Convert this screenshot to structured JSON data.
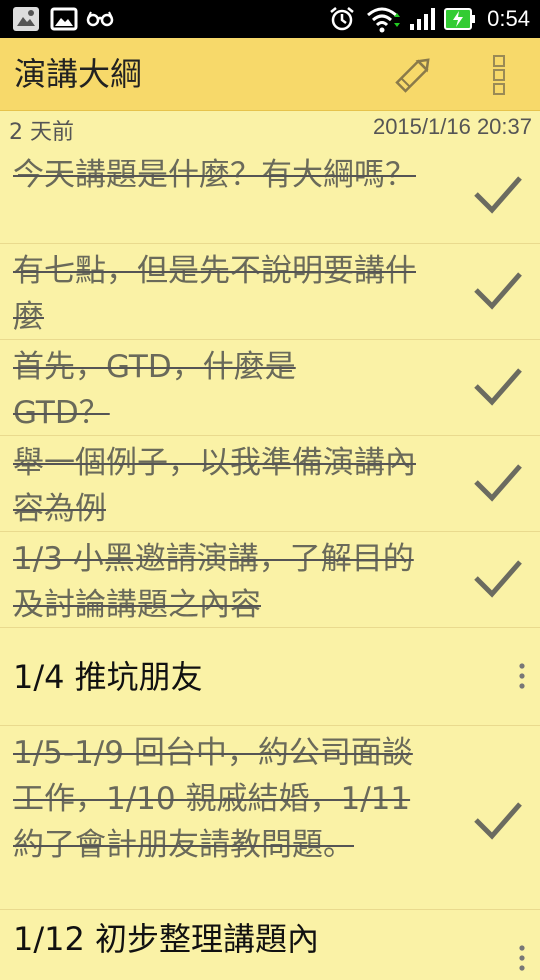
{
  "status_bar": {
    "time": "0:54",
    "icons": [
      "gallery-icon",
      "image-icon",
      "glasses-icon",
      "alarm-icon",
      "wifi-icon",
      "signal-icon",
      "battery-charging-icon"
    ]
  },
  "app_bar": {
    "title": "演講大綱",
    "actions": [
      "edit-pencil-icon",
      "overflow-menu-icon"
    ]
  },
  "meta": {
    "relative_time": "2 天前",
    "timestamp": "2015/1/16 20:37"
  },
  "items": [
    {
      "text": "今天講題是什麼？有大綱嗎？",
      "done": true
    },
    {
      "text": "有七點，但是先不說明要講什麼",
      "done": true
    },
    {
      "text": "首先，GTD，什麼是GTD？",
      "done": true
    },
    {
      "text": "舉一個例子，以我準備演講內容為例",
      "done": true
    },
    {
      "text": "1/3 小黑邀請演講，了解目的及討論講題之內容",
      "done": true
    },
    {
      "text": "1/4 推坑朋友",
      "done": false
    },
    {
      "text": "1/5-1/9 回台中，約公司面談工作，1/10 親戚結婚，1/11約了會計朋友請教問題。",
      "done": true
    },
    {
      "text": "1/12 初步整理講題內",
      "done": false
    }
  ],
  "colors": {
    "background": "#faf2a6",
    "app_bar": "#f7d96a",
    "done_text": "#6a6a5a",
    "check": "#6b6b60"
  }
}
